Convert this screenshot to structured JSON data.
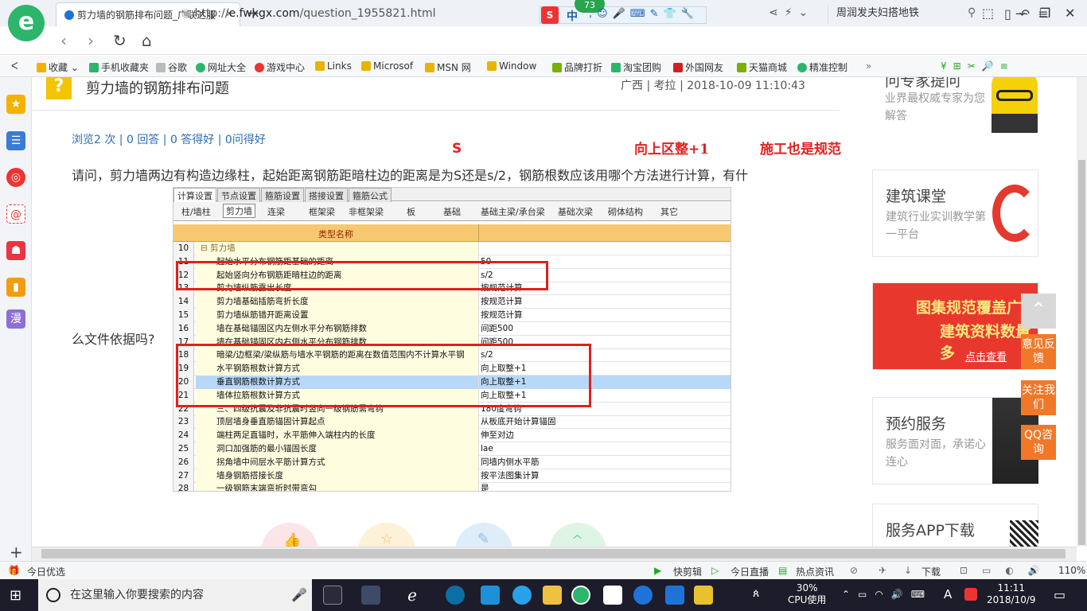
{
  "browser": {
    "tab_title": "剪力墙的钢筋排布问题_广联达服",
    "url_prefix": "http://",
    "url_host": "e.fwxgx.com",
    "url_path": "/question_1955821.html",
    "search_text": "周润发夫妇搭地铁",
    "ime_badge": "73",
    "ime_lang": "中"
  },
  "favorites": [
    {
      "label": "收藏",
      "color": "#f3b200"
    },
    {
      "label": "手机收藏夹",
      "color": "#2db56b"
    },
    {
      "label": "谷歌",
      "color": "#888888"
    },
    {
      "label": "网址大全",
      "color": "#2db56b"
    },
    {
      "label": "游戏中心",
      "color": "#e33"
    },
    {
      "label": "Links",
      "color": "#e8b400"
    },
    {
      "label": "Microsof",
      "color": "#e8b400"
    },
    {
      "label": "MSN 网",
      "color": "#e8b400"
    },
    {
      "label": "Window",
      "color": "#e8b400"
    },
    {
      "label": "品牌打折",
      "color": "#7ab000"
    },
    {
      "label": "淘宝团购",
      "color": "#2db56b"
    },
    {
      "label": "外国网友",
      "color": "#c22"
    },
    {
      "label": "天猫商城",
      "color": "#7ab000"
    },
    {
      "label": "精准控制",
      "color": "#2db56b"
    }
  ],
  "question": {
    "title": "剪力墙的钢筋排布问题",
    "meta": "广西 | 考拉 | 2018-10-09 11:10:43",
    "stats": "浏览2 次 | 0 回答 | 0 答得好 | 0问得好",
    "body_line1": "请问，剪力墙两边有构造边缘柱，起始距离钢筋距暗柱边的距离是为S还是s/2，钢筋根数应该用哪个方法进行计算，有什",
    "body_line2": "么文件依据吗?"
  },
  "annotations": {
    "s": "S",
    "a1": "向上区整+1",
    "a2": "施工也是规范"
  },
  "screenshot": {
    "tabs_top": [
      "计算设置",
      "节点设置",
      "箍筋设置",
      "搭接设置",
      "箍筋公式"
    ],
    "tabs_sub": [
      "柱/墙柱",
      "剪力墙",
      "连梁",
      "框架梁",
      "非框架梁",
      "板",
      "基础",
      "基础主梁/承台梁",
      "基础次梁",
      "砌体结构",
      "其它"
    ],
    "header": "类型名称",
    "rows": [
      {
        "n": "10",
        "k": "剪力墙",
        "v": "",
        "group": true
      },
      {
        "n": "11",
        "k": "起始水平分布钢筋距基础的距离",
        "v": "50"
      },
      {
        "n": "12",
        "k": "起始竖向分布钢筋距暗柱边的距离",
        "v": "s/2"
      },
      {
        "n": "13",
        "k": "剪力墙纵筋露出长度",
        "v": "按规范计算"
      },
      {
        "n": "14",
        "k": "剪力墙基础插筋弯折长度",
        "v": "按规范计算"
      },
      {
        "n": "15",
        "k": "剪力墙纵筋错开距离设置",
        "v": "按规范计算"
      },
      {
        "n": "16",
        "k": "墙在基础锚固区内左侧水平分布钢筋排数",
        "v": "间距500"
      },
      {
        "n": "17",
        "k": "墙在基础锚固区内右侧水平分布钢筋排数",
        "v": "间距500"
      },
      {
        "n": "18",
        "k": "暗梁/边框梁/梁纵筋与墙水平钢筋的距离在数值范围内不计算水平钢",
        "v": "s/2"
      },
      {
        "n": "19",
        "k": "水平钢筋根数计算方式",
        "v": "向上取整+1"
      },
      {
        "n": "20",
        "k": "垂直钢筋根数计算方式",
        "v": "向上取整+1",
        "selected": true
      },
      {
        "n": "21",
        "k": "墙体拉筋根数计算方式",
        "v": "向上取整+1"
      },
      {
        "n": "22",
        "k": "三、四级抗震及非抗震时竖向一级钢筋需弯钩",
        "v": "180度弯钩"
      },
      {
        "n": "23",
        "k": "顶层墙身垂直筋锚固计算起点",
        "v": "从板底开始计算锚固"
      },
      {
        "n": "24",
        "k": "端柱两足直锚时，水平筋伸入端柱内的长度",
        "v": "伸至对边"
      },
      {
        "n": "25",
        "k": "洞口加强筋的最小锚固长度",
        "v": "lae"
      },
      {
        "n": "26",
        "k": "拐角墙中间层水平筋计算方式",
        "v": "同墙内侧水平筋"
      },
      {
        "n": "27",
        "k": "墙身钢筋搭接长度",
        "v": "按平法图集计算"
      },
      {
        "n": "28",
        "k": "一级钢筋末端弯折时带弯勾",
        "v": "是"
      }
    ]
  },
  "right_sidebar": {
    "expert_title": "问专家提问",
    "expert_sub": "业界最权威专家为您解答",
    "course_title": "建筑课堂",
    "course_sub": "建筑行业实训教学第一平台",
    "promo_line1": "图集规范覆盖广",
    "promo_line2": "建筑资料数量多",
    "promo_link": "点击查看",
    "booking_title": "预约服务",
    "booking_sub": "服务面对面，承诺心连心",
    "app_title": "服务APP下载"
  },
  "float_buttons": [
    "意见反馈",
    "关注我们",
    "QQ咨询"
  ],
  "statusbar": {
    "left": "今日优选",
    "items": [
      "快剪辑",
      "今日直播",
      "热点资讯",
      "下载"
    ],
    "zoom": "110%"
  },
  "taskbar": {
    "search_placeholder": "在这里输入你要搜索的内容",
    "cpu": "30%",
    "cpu_label": "CPU使用",
    "time": "11:11",
    "date": "2018/10/9",
    "ime": "A"
  }
}
